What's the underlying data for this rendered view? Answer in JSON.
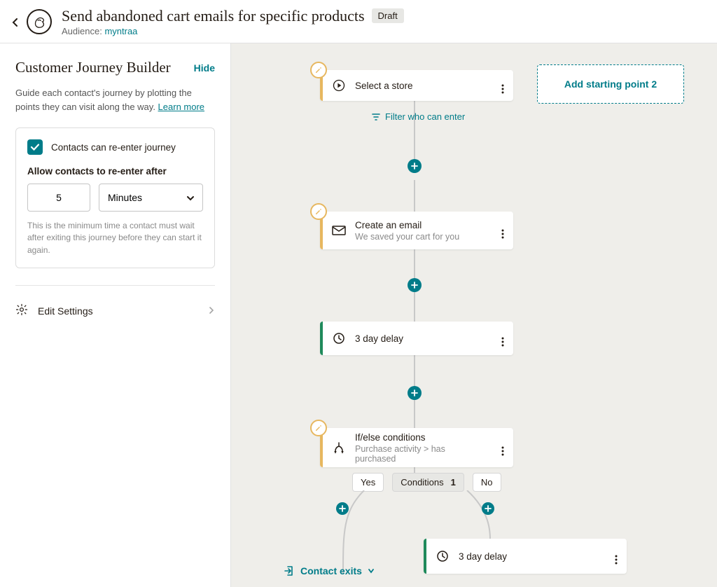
{
  "header": {
    "title": "Send abandoned cart emails for specific products",
    "status": "Draft",
    "audience_label": "Audience:",
    "audience_name": "myntraa"
  },
  "sidebar": {
    "title": "Customer Journey Builder",
    "hide": "Hide",
    "description_pre": "Guide each contact's journey by plotting the points they can visit along the way. ",
    "learn_more": "Learn more",
    "reenter": {
      "checkbox_label": "Contacts can re-enter journey",
      "checked": true,
      "allow_after_label": "Allow contacts to re-enter after",
      "value": "5",
      "unit": "Minutes",
      "helper": "This is the minimum time a contact must wait after exiting this journey before they can start it again."
    },
    "edit_settings": "Edit Settings"
  },
  "canvas": {
    "add_starting_point": "Add starting point 2",
    "filter_link": "Filter who can enter",
    "contact_exits": "Contact exits",
    "cards": {
      "start": {
        "title": "Select a store"
      },
      "email": {
        "title": "Create an email",
        "sub": "We saved your cart for you"
      },
      "delay1": {
        "title": "3 day delay"
      },
      "ifelse": {
        "title": "If/else conditions",
        "sub": "Purchase activity > has purchased"
      },
      "delay2": {
        "title": "3 day delay"
      }
    },
    "branch": {
      "yes": "Yes",
      "conditions_label": "Conditions",
      "conditions_count": "1",
      "no": "No"
    }
  }
}
